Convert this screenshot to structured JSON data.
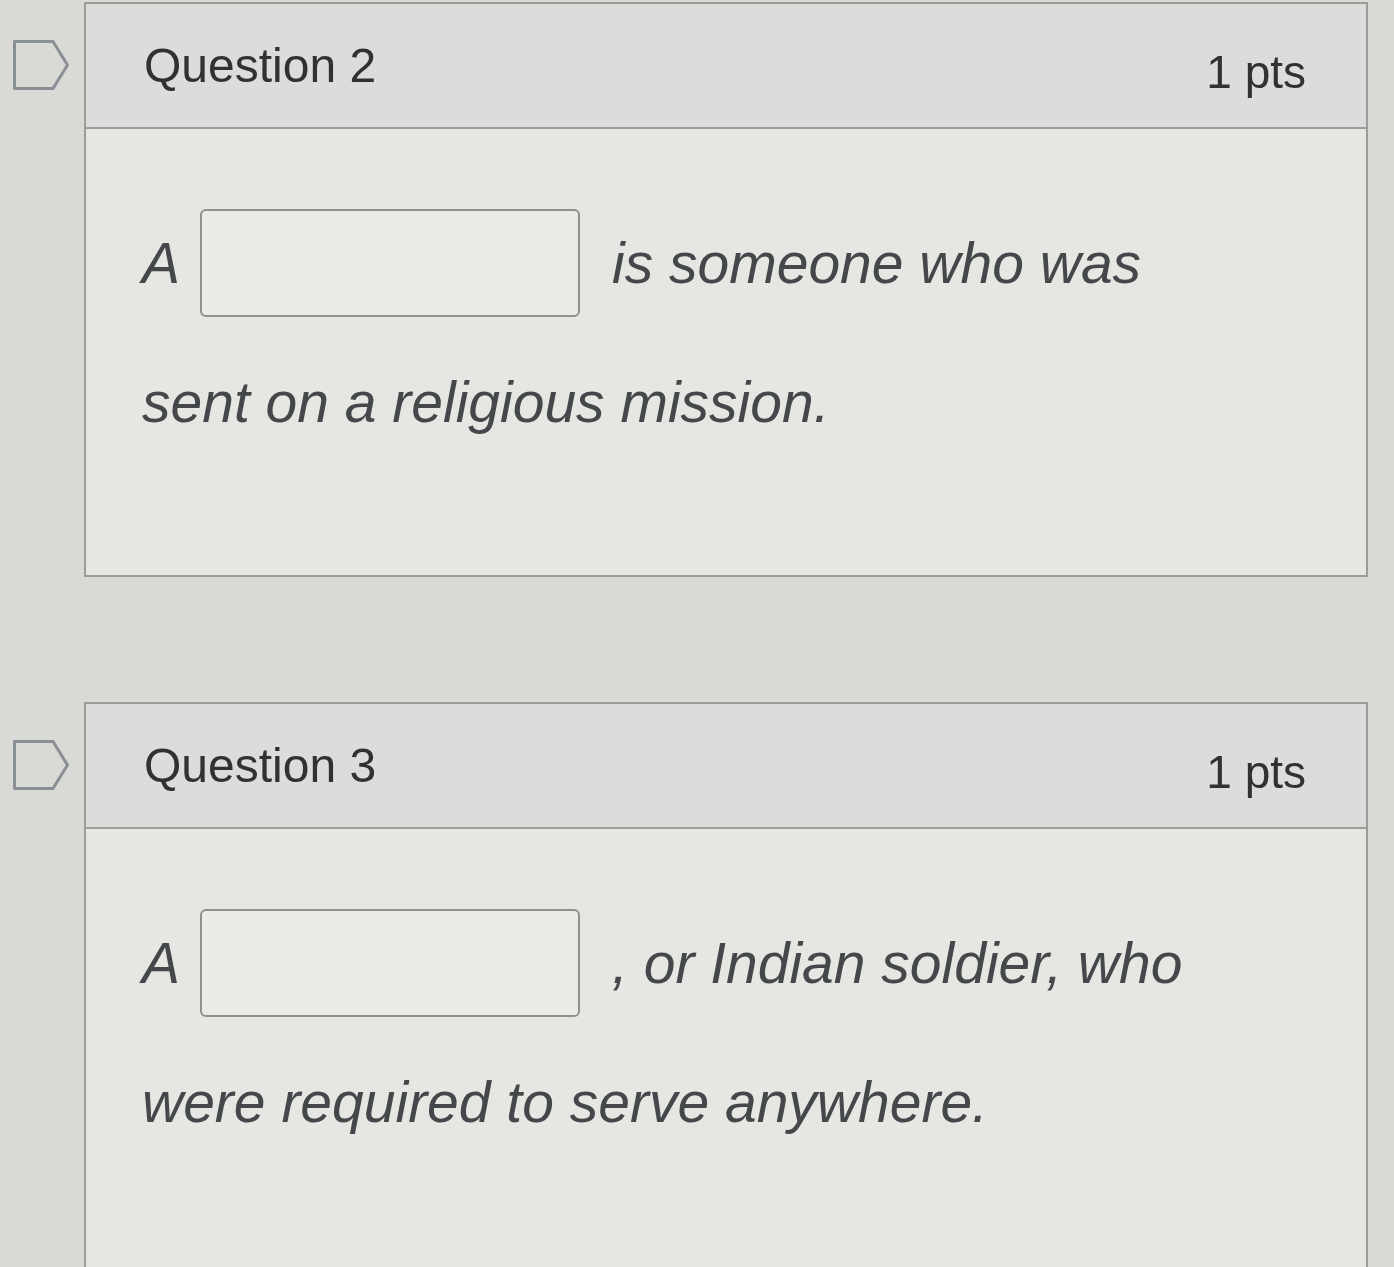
{
  "questions": [
    {
      "flagged": false,
      "title": "Question 2",
      "points": "1 pts",
      "lines": [
        [
          {
            "kind": "text",
            "text": "A"
          },
          {
            "kind": "blank"
          },
          {
            "kind": "text",
            "text": "is someone who was"
          }
        ],
        [
          {
            "kind": "text",
            "text": "sent on a religious mission."
          }
        ]
      ]
    },
    {
      "flagged": false,
      "title": "Question 3",
      "points": "1 pts",
      "lines": [
        [
          {
            "kind": "text",
            "text": "A"
          },
          {
            "kind": "blank"
          },
          {
            "kind": "text",
            "text": ", or Indian soldier, who"
          }
        ],
        [
          {
            "kind": "text",
            "text": "were required to serve anywhere."
          }
        ]
      ]
    }
  ]
}
